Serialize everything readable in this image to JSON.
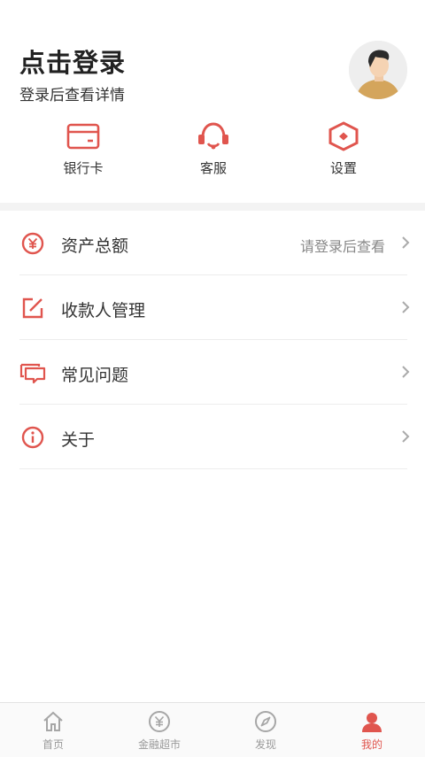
{
  "colors": {
    "accent": "#e0554e",
    "text": "#333333",
    "muted": "#888888",
    "tab_inactive": "#999999"
  },
  "header": {
    "title": "点击登录",
    "subtitle": "登录后查看详情",
    "avatar_icon": "user-avatar-illustration"
  },
  "quick_actions": [
    {
      "label": "银行卡",
      "icon": "bank-card-icon"
    },
    {
      "label": "客服",
      "icon": "headset-icon"
    },
    {
      "label": "设置",
      "icon": "settings-hexagon-icon"
    }
  ],
  "menu": [
    {
      "label": "资产总额",
      "value": "请登录后查看",
      "icon": "yen-circle-icon"
    },
    {
      "label": "收款人管理",
      "value": "",
      "icon": "edit-icon"
    },
    {
      "label": "常见问题",
      "value": "",
      "icon": "chat-bubbles-icon"
    },
    {
      "label": "关于",
      "value": "",
      "icon": "info-circle-icon"
    }
  ],
  "tabbar": [
    {
      "label": "首页",
      "icon": "home-icon",
      "active": false
    },
    {
      "label": "金融超市",
      "icon": "yen-circle-icon",
      "active": false
    },
    {
      "label": "发现",
      "icon": "compass-icon",
      "active": false
    },
    {
      "label": "我的",
      "icon": "user-icon",
      "active": true
    }
  ]
}
